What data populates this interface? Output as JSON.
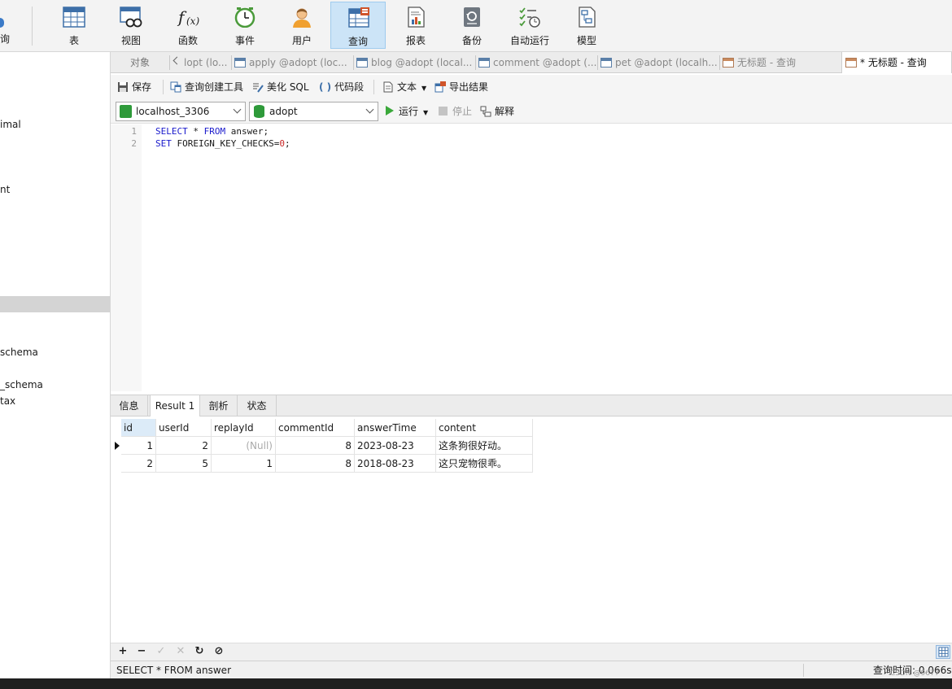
{
  "toolbar": {
    "partial_left": "询",
    "buttons": [
      {
        "label": "表"
      },
      {
        "label": "视图"
      },
      {
        "label": "函数"
      },
      {
        "label": "事件"
      },
      {
        "label": "用户"
      },
      {
        "label": "查询"
      },
      {
        "label": "报表"
      },
      {
        "label": "备份"
      },
      {
        "label": "自动运行"
      },
      {
        "label": "模型"
      }
    ],
    "active": "查询"
  },
  "nav": {
    "items": [
      "imal",
      "nt",
      "schema",
      "_schema",
      "tax"
    ]
  },
  "tabs": {
    "objects_label": "对象",
    "items": [
      {
        "label": "lopt (lo..."
      },
      {
        "label": "apply @adopt (loc..."
      },
      {
        "label": "blog @adopt (local..."
      },
      {
        "label": "comment @adopt (..."
      },
      {
        "label": "pet @adopt (localh..."
      },
      {
        "label": "无标题 - 查询"
      },
      {
        "label": "* 无标题 - 查询"
      }
    ]
  },
  "actions": {
    "save": "保存",
    "query_builder": "查询创建工具",
    "beautify": "美化 SQL",
    "snippet": "代码段",
    "text": "文本",
    "export": "导出结果"
  },
  "connection": {
    "server": "localhost_3306",
    "database": "adopt",
    "run": "运行",
    "stop": "停止",
    "explain": "解释"
  },
  "editor": {
    "line_numbers": [
      "1",
      "2"
    ],
    "line1": {
      "kw1": "SELECT",
      "mid": " * ",
      "kw2": "FROM",
      "rest": " answer;"
    },
    "line2": {
      "kw": "SET",
      "rest": " FOREIGN_KEY_CHECKS=",
      "num": "0",
      "end": ";"
    }
  },
  "result_tabs": [
    "信息",
    "Result 1",
    "剖析",
    "状态"
  ],
  "grid": {
    "columns": [
      "id",
      "userId",
      "replayId",
      "commentId",
      "answerTime",
      "content"
    ],
    "rows": [
      [
        "1",
        "2",
        "(Null)",
        "8",
        "2023-08-23",
        "这条狗很好动。"
      ],
      [
        "2",
        "5",
        "1",
        "8",
        "2018-08-23",
        "这只宠物很乖。"
      ]
    ]
  },
  "status": {
    "sql": "SELECT * FROM answer",
    "time": "查询时间: 0.066s",
    "watermark": "CSDN @9677"
  },
  "colors": {
    "active_tab_bg": "#cce4f7",
    "selected_header": "#dcebf8",
    "keyword": "#1a1acc",
    "number": "#c82828"
  }
}
